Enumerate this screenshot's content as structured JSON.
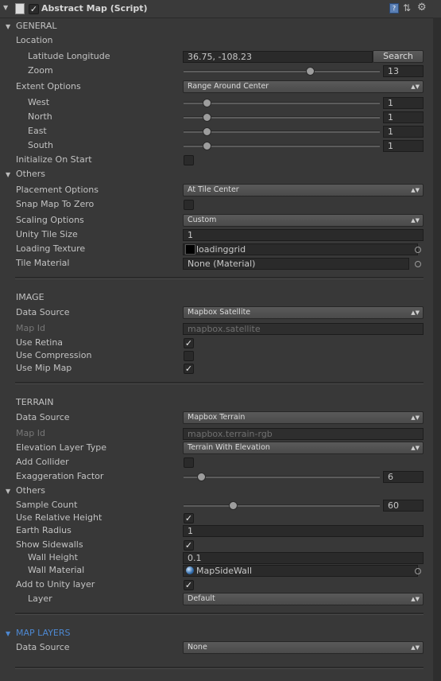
{
  "header": {
    "title": "Abstract Map (Script)",
    "enabled": true,
    "icons": [
      "script-icon",
      "help-icon",
      "preset-icon",
      "settings-icon"
    ]
  },
  "general": {
    "section": "GENERAL",
    "location_label": "Location",
    "latlon_label": "Latitude Longitude",
    "latlon_value": "36.75, -108.23",
    "search_label": "Search",
    "zoom_label": "Zoom",
    "zoom_value": "13",
    "extent_label": "Extent Options",
    "extent_value": "Range Around Center",
    "west_label": "West",
    "west_value": "1",
    "north_label": "North",
    "north_value": "1",
    "east_label": "East",
    "east_value": "1",
    "south_label": "South",
    "south_value": "1",
    "init_label": "Initialize On Start",
    "others_label": "Others",
    "placement_label": "Placement Options",
    "placement_value": "At Tile Center",
    "snap_label": "Snap Map To Zero",
    "scaling_label": "Scaling Options",
    "scaling_value": "Custom",
    "tile_size_label": "Unity Tile Size",
    "tile_size_value": "1",
    "loading_tex_label": "Loading Texture",
    "loading_tex_value": "loadinggrid",
    "tile_mat_label": "Tile Material",
    "tile_mat_value": "None (Material)"
  },
  "image": {
    "section": "IMAGE",
    "source_label": "Data Source",
    "source_value": "Mapbox Satellite",
    "mapid_label": "Map Id",
    "mapid_value": "mapbox.satellite",
    "retina_label": "Use Retina",
    "compression_label": "Use Compression",
    "mipmap_label": "Use Mip Map"
  },
  "terrain": {
    "section": "TERRAIN",
    "source_label": "Data Source",
    "source_value": "Mapbox Terrain",
    "mapid_label": "Map Id",
    "mapid_value": "mapbox.terrain-rgb",
    "elev_label": "Elevation Layer Type",
    "elev_value": "Terrain With Elevation",
    "collider_label": "Add Collider",
    "exag_label": "Exaggeration Factor",
    "exag_value": "6",
    "others_label": "Others",
    "sample_label": "Sample Count",
    "sample_value": "60",
    "relheight_label": "Use Relative Height",
    "radius_label": "Earth Radius",
    "radius_value": "1",
    "sidewalls_label": "Show Sidewalls",
    "wall_height_label": "Wall Height",
    "wall_height_value": "0.1",
    "wall_mat_label": "Wall Material",
    "wall_mat_value": "MapSideWall",
    "addlayer_label": "Add to Unity layer",
    "layer_label": "Layer",
    "layer_value": "Default"
  },
  "map_layers": {
    "section": "MAP LAYERS",
    "source_label": "Data Source",
    "source_value": "None"
  },
  "sliders": {
    "zoom": 0.65,
    "west": 0.1,
    "north": 0.1,
    "east": 0.1,
    "south": 0.1,
    "exag": 0.07,
    "sample": 0.24
  },
  "checks": {
    "init_on_start": false,
    "snap_to_zero": false,
    "use_retina": true,
    "use_compression": false,
    "use_mipmap": true,
    "add_collider": false,
    "use_relative_height": true,
    "show_sidewalls": true,
    "add_to_unity_layer": true
  },
  "colors": {
    "accent": "#4d88d1",
    "background": "#383838"
  }
}
